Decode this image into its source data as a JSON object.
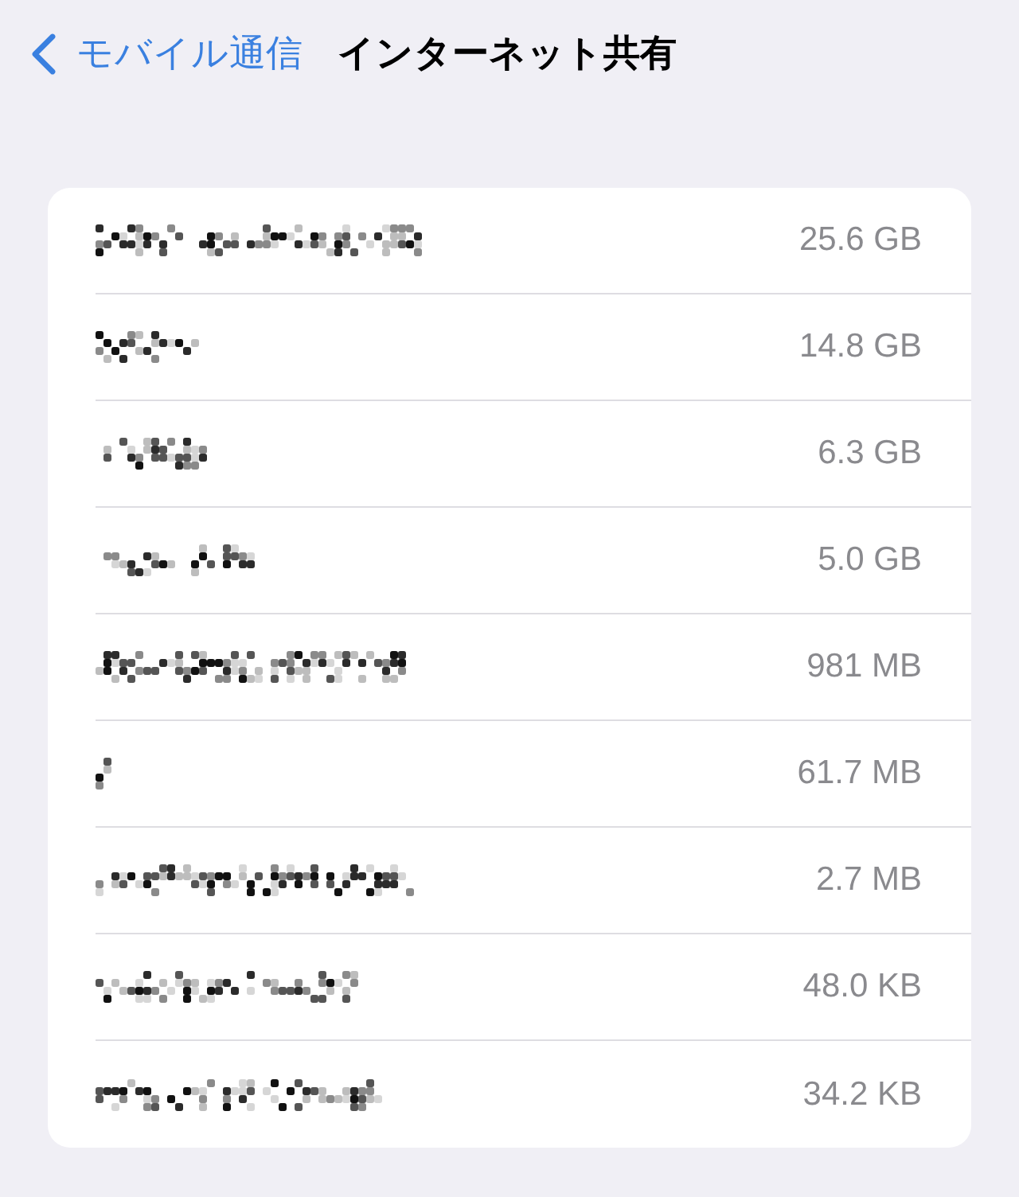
{
  "nav": {
    "back_label": "モバイル通信",
    "title": "インターネット共有"
  },
  "devices": [
    {
      "usage": "25.6 GB"
    },
    {
      "usage": "14.8 GB"
    },
    {
      "usage": "6.3 GB"
    },
    {
      "usage": "5.0 GB"
    },
    {
      "usage": "981 MB"
    },
    {
      "usage": "61.7 MB"
    },
    {
      "usage": "2.7 MB"
    },
    {
      "usage": "48.0 KB"
    },
    {
      "usage": "34.2 KB"
    }
  ]
}
